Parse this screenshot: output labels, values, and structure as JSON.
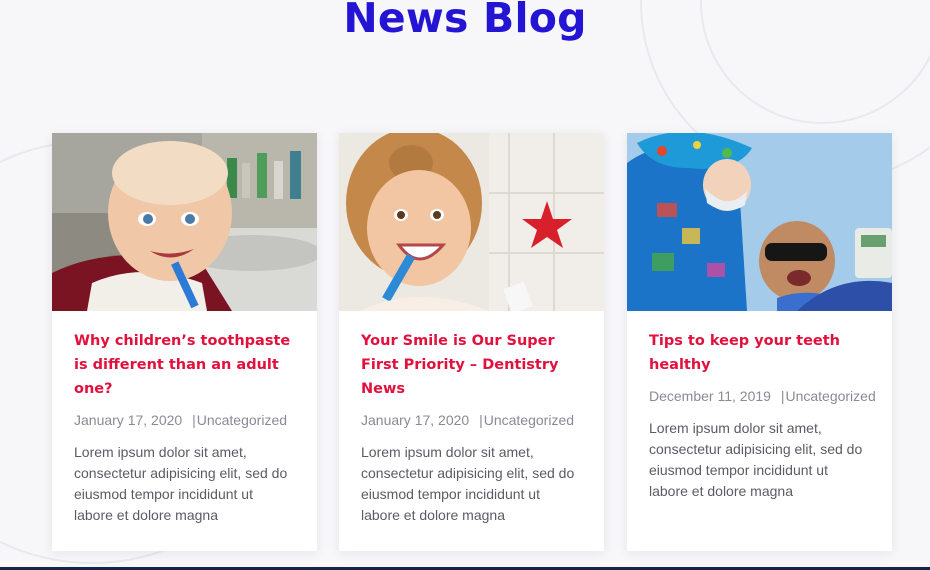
{
  "header": {
    "title": "News Blog"
  },
  "posts": [
    {
      "title": "Why children’s toothpaste is different than an adult one?",
      "date": "January 17, 2020",
      "separator": "|",
      "category": "Uncategorized",
      "excerpt": "Lorem ipsum dolor sit amet, consectetur adipisicing elit, sed do eiusmod tempor incididunt ut labore et dolore magna",
      "image_alt": "baby brushing teeth"
    },
    {
      "title": "Your Smile is Our Super First Priority – Dentistry News",
      "date": "January 17, 2020",
      "separator": "|",
      "category": "Uncategorized",
      "excerpt": "Lorem ipsum dolor sit amet, consectetur adipisicing elit, sed do eiusmod tempor incididunt ut labore et dolore magna",
      "image_alt": "girl brushing teeth"
    },
    {
      "title": "Tips to keep your teeth healthy",
      "date": "December 11, 2019",
      "separator": "|",
      "category": "Uncategorized",
      "excerpt": "Lorem ipsum dolor sit amet, consectetur adipisicing elit, sed do eiusmod tempor incididunt ut labore et dolore magna",
      "image_alt": "dentist with child patient"
    }
  ],
  "colors": {
    "title": "#2414d4",
    "post_title": "#e2103c",
    "meta": "#8a8a96",
    "excerpt": "#5b5b66"
  }
}
